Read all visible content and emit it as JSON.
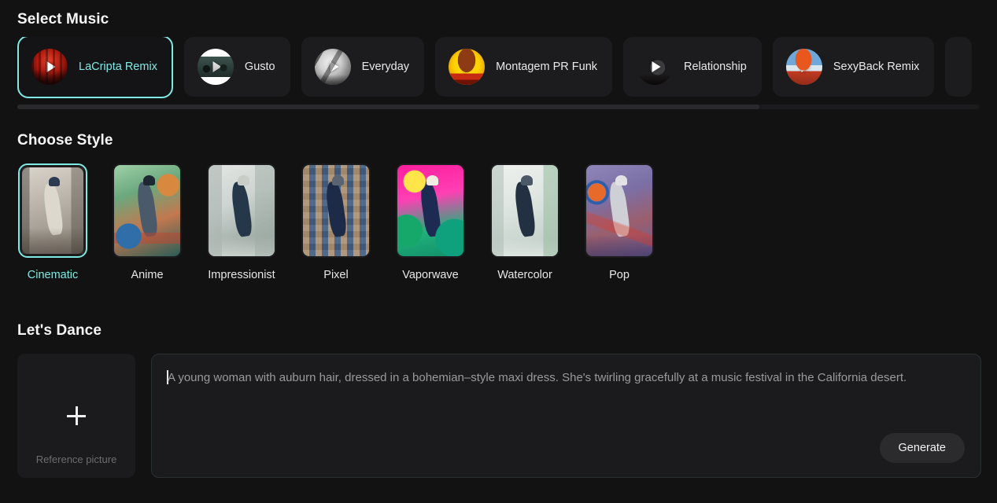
{
  "music": {
    "title": "Select Music",
    "tracks": [
      {
        "name": "LaCripta Remix",
        "selected": true,
        "icon": "play-icon"
      },
      {
        "name": "Gusto",
        "selected": false,
        "icon": "play-icon"
      },
      {
        "name": "Everyday",
        "selected": false,
        "icon": "play-icon"
      },
      {
        "name": "Montagem PR Funk",
        "selected": false,
        "icon": "play-icon"
      },
      {
        "name": "Relationship",
        "selected": false,
        "icon": "play-icon"
      },
      {
        "name": "SexyBack Remix",
        "selected": false,
        "icon": "play-icon"
      }
    ]
  },
  "style": {
    "title": "Choose Style",
    "items": [
      {
        "label": "Cinematic",
        "selected": true
      },
      {
        "label": "Anime",
        "selected": false
      },
      {
        "label": "Impressionist",
        "selected": false
      },
      {
        "label": "Pixel",
        "selected": false
      },
      {
        "label": "Vaporwave",
        "selected": false
      },
      {
        "label": "Watercolor",
        "selected": false
      },
      {
        "label": "Pop",
        "selected": false
      }
    ]
  },
  "dance": {
    "title": "Let's Dance",
    "reference": {
      "label": "Reference picture",
      "icon": "plus-icon"
    },
    "prompt": {
      "value": "A young woman with auburn hair, dressed in a bohemian–style maxi dress. She's twirling gracefully at a music festival in the California desert.",
      "placeholder": "Describe your dance video"
    },
    "generate_label": "Generate"
  },
  "colors": {
    "accent": "#7fe9e3",
    "page_background": "#121212",
    "card_background": "#1c1c1e"
  }
}
